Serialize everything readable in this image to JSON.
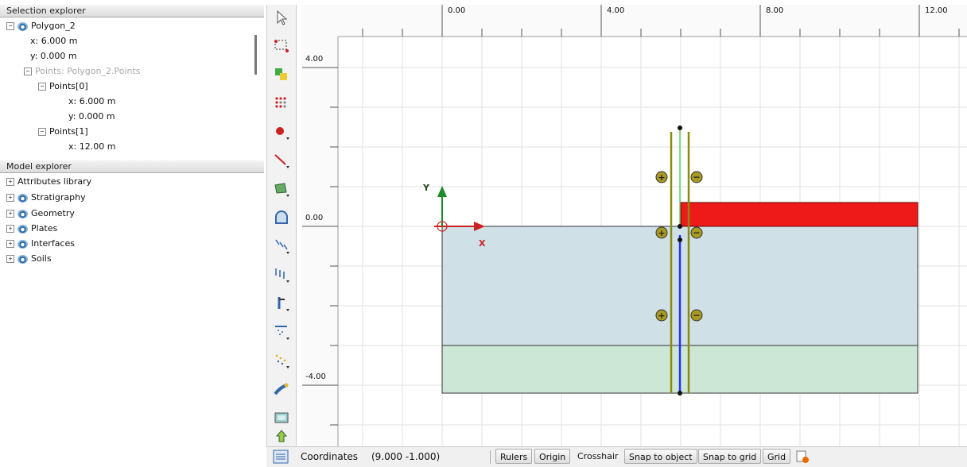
{
  "selection_explorer": {
    "title": "Selection explorer",
    "items": [
      {
        "label": "Polygon_2"
      },
      {
        "label": "x: 6.000 m"
      },
      {
        "label": "y: 0.000 m"
      },
      {
        "label": "Points: Polygon_2.Points"
      },
      {
        "label": "Points[0]"
      },
      {
        "label": "x: 6.000 m"
      },
      {
        "label": "y: 0.000 m"
      },
      {
        "label": "Points[1]"
      },
      {
        "label": "x: 12.00 m"
      }
    ]
  },
  "model_explorer": {
    "title": "Model explorer",
    "items": [
      {
        "label": "Attributes library"
      },
      {
        "label": "Stratigraphy"
      },
      {
        "label": "Geometry"
      },
      {
        "label": "Plates"
      },
      {
        "label": "Interfaces"
      },
      {
        "label": "Soils"
      }
    ]
  },
  "toolbar": {
    "icons": [
      "select-pointer-icon",
      "select-rectangle-icon",
      "move-object-icon",
      "point-array-icon",
      "create-point-icon",
      "create-line-icon",
      "create-polygon-icon",
      "create-tunnel-icon",
      "point-load-icon",
      "line-load-icon",
      "create-anchor-icon",
      "displacement-icon",
      "pore-pressure-icon",
      "thermal-icon",
      "colour-palette-icon",
      "import-geometry-icon",
      "design-approach-icon"
    ]
  },
  "canvas": {
    "ruler_x_labels": [
      "0.00",
      "4.00",
      "8.00",
      "12.00"
    ],
    "ruler_y_labels": [
      "4.00",
      "0.00",
      "-4.00"
    ],
    "axis_x_label": "X",
    "axis_y_label": "Y",
    "colors": {
      "upper_soil": "#cfe0e6",
      "lower_soil": "#cde7d6",
      "load_red": "#ee1a1a",
      "plate_blue": "#2233ee",
      "interface_olive": "#8a8a10"
    }
  },
  "statusbar": {
    "coordinates_label": "Coordinates",
    "coordinates_value": "(9.000 -1.000)",
    "rulers": "Rulers",
    "origin": "Origin",
    "crosshair": "Crosshair",
    "snap_to_object": "Snap to object",
    "snap_to_grid": "Snap to grid",
    "grid": "Grid"
  }
}
